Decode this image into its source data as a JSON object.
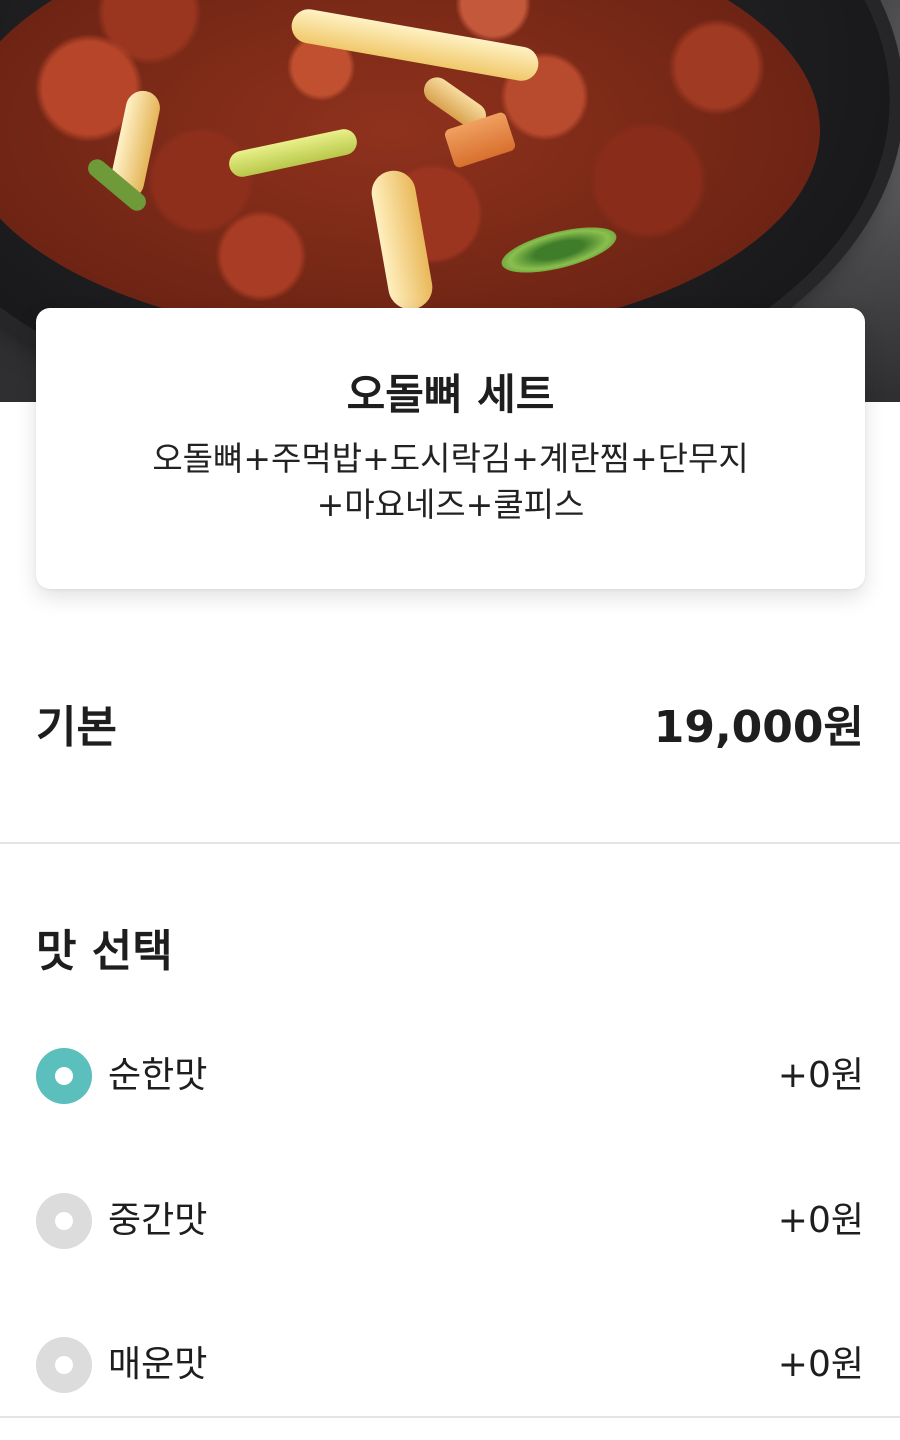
{
  "menu": {
    "title": "오돌뼈 세트",
    "description_line1": "오돌뼈+주먹밥+도시락김+계란찜+단무지",
    "description_line2": "+마요네즈+쿨피스"
  },
  "base": {
    "label": "기본",
    "price": "19,000원"
  },
  "taste_section": {
    "title": "맛 선택",
    "selected_color": "#5bbfbd",
    "unselected_color": "#dcdcdc",
    "options": [
      {
        "label": "순한맛",
        "price": "+0원",
        "selected": true
      },
      {
        "label": "중간맛",
        "price": "+0원",
        "selected": false
      },
      {
        "label": "매운맛",
        "price": "+0원",
        "selected": false
      }
    ]
  }
}
